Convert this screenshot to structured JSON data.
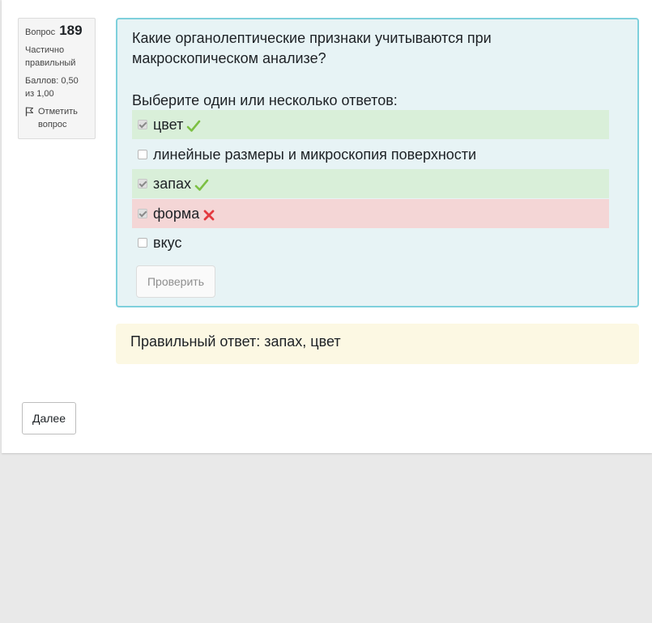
{
  "question_info": {
    "label": "Вопрос",
    "number": "189",
    "state": "Частично правильный",
    "grade": "Баллов: 0,50 из 1,00",
    "flag_label": "Отметить вопрос"
  },
  "question": {
    "text": "Какие органолептические признаки учитываются при макроскопическом анализе?",
    "prompt": "Выберите один или несколько ответов:",
    "answers": [
      {
        "label": "цвет",
        "checked": true,
        "status": "correct",
        "mark": "check-icon"
      },
      {
        "label": "линейные размеры и микроскопия поверхности",
        "checked": false,
        "status": "none",
        "mark": ""
      },
      {
        "label": "запах",
        "checked": true,
        "status": "correct",
        "mark": "check-icon"
      },
      {
        "label": "форма",
        "checked": true,
        "status": "incorrect",
        "mark": "cross-icon"
      },
      {
        "label": "вкус",
        "checked": false,
        "status": "none",
        "mark": ""
      }
    ],
    "check_button": "Проверить"
  },
  "feedback": {
    "right_answer": "Правильный ответ: запах, цвет"
  },
  "nav": {
    "next_button": "Далее"
  },
  "colors": {
    "correct_bg": "#d9efd9",
    "incorrect_bg": "#f4d6d6",
    "formulation_border": "#7ed0dc",
    "feedback_bg": "#fcf8e3",
    "check_mark": "#7cc043",
    "cross_mark": "#e3393f"
  }
}
